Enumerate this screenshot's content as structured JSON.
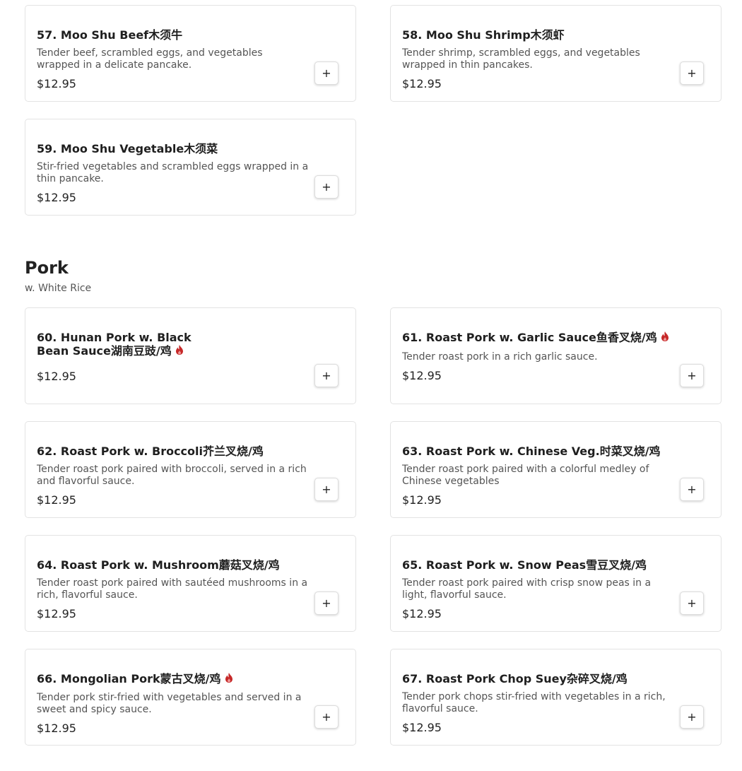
{
  "section": {
    "title": "Pork",
    "subtitle": "w. White Rice"
  },
  "add_label": "+",
  "spicy_icon": "flame-icon",
  "spicy_color": "#c62828",
  "items": [
    {
      "title": "57. Moo Shu Beef木须牛",
      "desc": "Tender beef, scrambled eggs, and vegetables wrapped in a delicate pancake.",
      "price": "$12.95",
      "spicy": false
    },
    {
      "title": "58. Moo Shu Shrimp木须虾",
      "desc": "Tender shrimp, scrambled eggs, and vegetables wrapped in thin pancakes.",
      "price": "$12.95",
      "spicy": false
    },
    {
      "title": "59. Moo Shu Vegetable木须菜",
      "desc": "Stir-fried vegetables and scrambled eggs wrapped in a thin pancake.",
      "price": "$12.95",
      "spicy": false
    },
    {
      "title": "60. Hunan Pork w. Black Bean Sauce湖南豆豉/鸡",
      "desc": "",
      "price": "$12.95",
      "spicy": true
    },
    {
      "title": "61. Roast Pork w. Garlic Sauce鱼香叉烧/鸡",
      "desc": "Tender roast pork in a rich garlic sauce.",
      "price": "$12.95",
      "spicy": true
    },
    {
      "title": "62. Roast Pork w. Broccoli芥兰叉烧/鸡",
      "desc": "Tender roast pork paired with broccoli, served in a rich and flavorful sauce.",
      "price": "$12.95",
      "spicy": false
    },
    {
      "title": "63. Roast Pork w. Chinese Veg.时菜叉烧/鸡",
      "desc": "Tender roast pork paired with a colorful medley of Chinese vegetables",
      "price": "$12.95",
      "spicy": false
    },
    {
      "title": "64. Roast Pork w. Mushroom蘑菇叉烧/鸡",
      "desc": "Tender roast pork paired with sautéed mushrooms in a rich, flavorful sauce.",
      "price": "$12.95",
      "spicy": false
    },
    {
      "title": "65. Roast Pork w. Snow Peas雪豆叉烧/鸡",
      "desc": "Tender roast pork paired with crisp snow peas in a light, flavorful sauce.",
      "price": "$12.95",
      "spicy": false
    },
    {
      "title": "66. Mongolian Pork蒙古叉烧/鸡",
      "desc": "Tender pork stir-fried with vegetables and served in a sweet and spicy sauce.",
      "price": "$12.95",
      "spicy": true
    },
    {
      "title": "67. Roast Pork Chop Suey杂碎叉烧/鸡",
      "desc": "Tender pork chops stir-fried with vegetables in a rich, flavorful sauce.",
      "price": "$12.95",
      "spicy": false
    }
  ]
}
